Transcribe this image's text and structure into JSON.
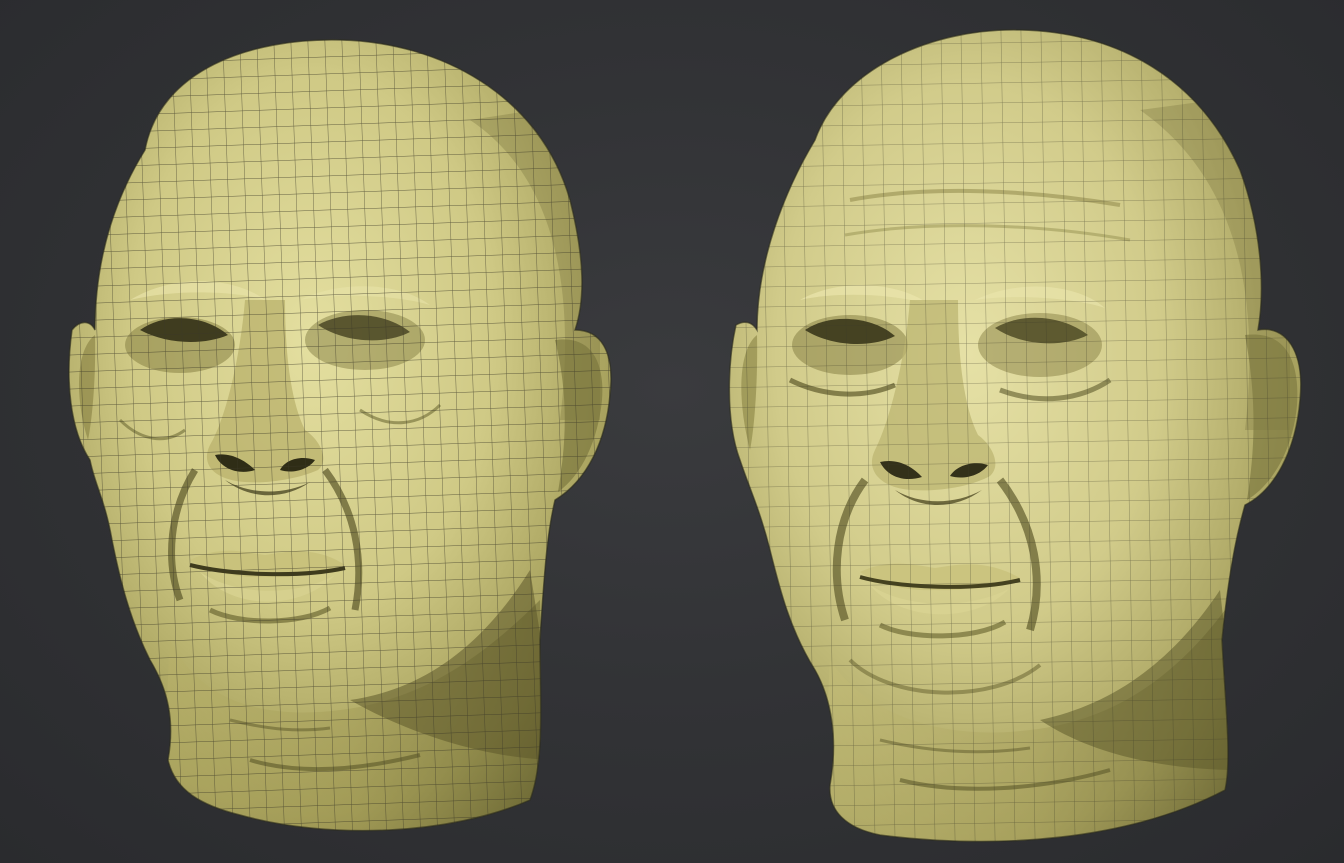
{
  "scene": {
    "background_color": "#323336",
    "clay_color": "#cfca84",
    "clay_shadow_color": "#6e6a35",
    "wire_color": "#3a3826"
  },
  "models": [
    {
      "id": "low-resolution-head",
      "description_icon": "head-mesh-icon",
      "subdivision": "low"
    },
    {
      "id": "high-resolution-head",
      "description_icon": "head-mesh-icon",
      "subdivision": "high"
    }
  ]
}
